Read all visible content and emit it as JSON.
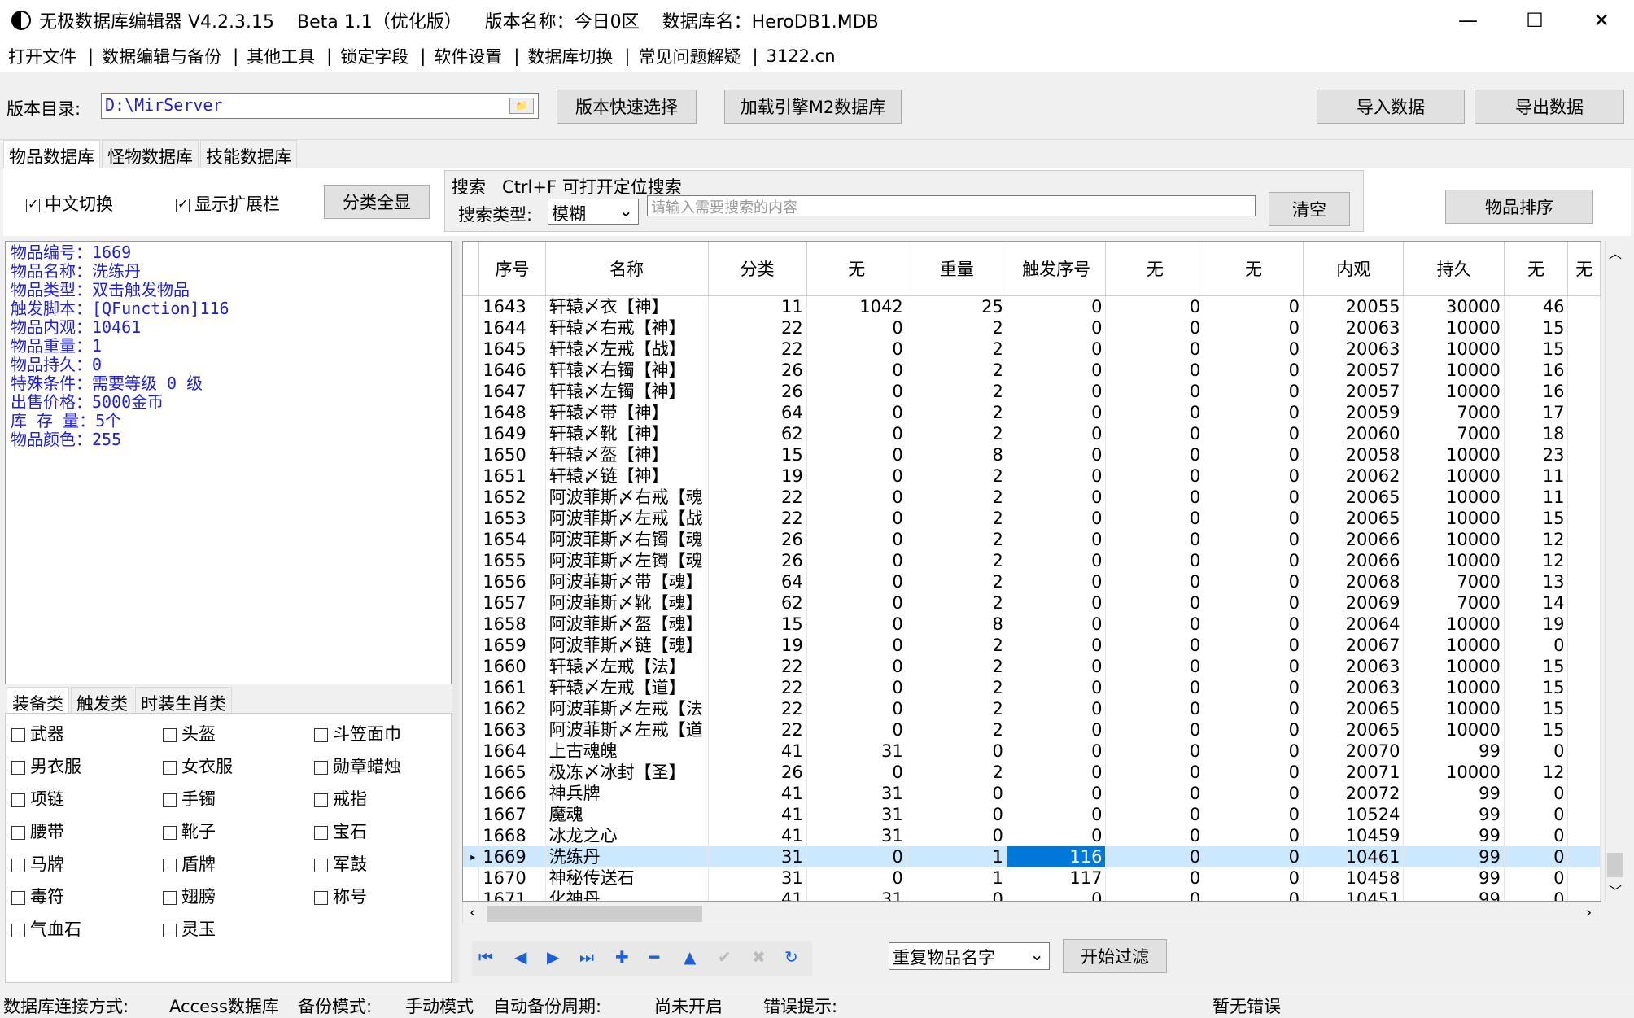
{
  "window": {
    "title": "无极数据库编辑器 V4.2.3.15    Beta 1.1（优化版）    版本名称：今日0区    数据库名：HeroDB1.MDB",
    "minimize": "—",
    "maximize": "☐",
    "close": "✕"
  },
  "menu": [
    "打开文件",
    "数据编辑与备份",
    "其他工具",
    "锁定字段",
    "软件设置",
    "数据库切换",
    "常见问题解疑",
    "3122.cn"
  ],
  "toolbar": {
    "dir_label": "版本目录:",
    "dir_value": "D:\\MirServer",
    "quick_select": "版本快速选择",
    "load_m2": "加载引擎M2数据库",
    "import": "导入数据",
    "export": "导出数据"
  },
  "main_tabs": [
    "物品数据库",
    "怪物数据库",
    "技能数据库"
  ],
  "options": {
    "cn_switch": "中文切换",
    "show_ext": "显示扩展栏",
    "show_all": "分类全显",
    "search_title": "搜索   Ctrl+F 可打开定位搜索",
    "search_type_label": "搜索类型:",
    "search_type_value": "模糊",
    "search_placeholder": "请输入需要搜索的内容",
    "clear": "清空",
    "sort": "物品排序"
  },
  "info": [
    "物品编号：1669",
    "物品名称：洗练丹",
    "物品类型：双击触发物品",
    "触发脚本：[QFunction]116",
    "物品内观：10461",
    "物品重量：1",
    "物品持久：0",
    "特殊条件：需要等级 0 级",
    "出售价格：5000金币",
    "库 存 量：5个",
    "物品颜色：255"
  ],
  "cat_tabs": [
    "装备类",
    "触发类",
    "时装生肖类"
  ],
  "categories": [
    "武器",
    "头盔",
    "斗笠面巾",
    "男衣服",
    "女衣服",
    "勋章蜡烛",
    "项链",
    "手镯",
    "戒指",
    "腰带",
    "靴子",
    "宝石",
    "马牌",
    "盾牌",
    "军鼓",
    "毒符",
    "翅膀",
    "称号",
    "气血石",
    "灵玉"
  ],
  "grid": {
    "headers": [
      "序号",
      "名称",
      "分类",
      "无",
      "重量",
      "触发序号",
      "无",
      "无",
      "内观",
      "持久",
      "无",
      "无"
    ],
    "rows": [
      [
        "1643",
        "轩辕〆衣【神】",
        "11",
        "1042",
        "25",
        "0",
        "0",
        "0",
        "20055",
        "30000",
        "46"
      ],
      [
        "1644",
        "轩辕〆右戒【神】",
        "22",
        "0",
        "2",
        "0",
        "0",
        "0",
        "20063",
        "10000",
        "15"
      ],
      [
        "1645",
        "轩辕〆左戒【战】",
        "22",
        "0",
        "2",
        "0",
        "0",
        "0",
        "20063",
        "10000",
        "15"
      ],
      [
        "1646",
        "轩辕〆右镯【神】",
        "26",
        "0",
        "2",
        "0",
        "0",
        "0",
        "20057",
        "10000",
        "16"
      ],
      [
        "1647",
        "轩辕〆左镯【神】",
        "26",
        "0",
        "2",
        "0",
        "0",
        "0",
        "20057",
        "10000",
        "16"
      ],
      [
        "1648",
        "轩辕〆带【神】",
        "64",
        "0",
        "2",
        "0",
        "0",
        "0",
        "20059",
        "7000",
        "17"
      ],
      [
        "1649",
        "轩辕〆靴【神】",
        "62",
        "0",
        "2",
        "0",
        "0",
        "0",
        "20060",
        "7000",
        "18"
      ],
      [
        "1650",
        "轩辕〆盔【神】",
        "15",
        "0",
        "8",
        "0",
        "0",
        "0",
        "20058",
        "10000",
        "23"
      ],
      [
        "1651",
        "轩辕〆链【神】",
        "19",
        "0",
        "2",
        "0",
        "0",
        "0",
        "20062",
        "10000",
        "11"
      ],
      [
        "1652",
        "阿波菲斯〆右戒【魂",
        "22",
        "0",
        "2",
        "0",
        "0",
        "0",
        "20065",
        "10000",
        "11"
      ],
      [
        "1653",
        "阿波菲斯〆左戒【战",
        "22",
        "0",
        "2",
        "0",
        "0",
        "0",
        "20065",
        "10000",
        "15"
      ],
      [
        "1654",
        "阿波菲斯〆右镯【魂",
        "26",
        "0",
        "2",
        "0",
        "0",
        "0",
        "20066",
        "10000",
        "12"
      ],
      [
        "1655",
        "阿波菲斯〆左镯【魂",
        "26",
        "0",
        "2",
        "0",
        "0",
        "0",
        "20066",
        "10000",
        "12"
      ],
      [
        "1656",
        "阿波菲斯〆带【魂】",
        "64",
        "0",
        "2",
        "0",
        "0",
        "0",
        "20068",
        "7000",
        "13"
      ],
      [
        "1657",
        "阿波菲斯〆靴【魂】",
        "62",
        "0",
        "2",
        "0",
        "0",
        "0",
        "20069",
        "7000",
        "14"
      ],
      [
        "1658",
        "阿波菲斯〆盔【魂】",
        "15",
        "0",
        "8",
        "0",
        "0",
        "0",
        "20064",
        "10000",
        "19"
      ],
      [
        "1659",
        "阿波菲斯〆链【魂】",
        "19",
        "0",
        "2",
        "0",
        "0",
        "0",
        "20067",
        "10000",
        "0"
      ],
      [
        "1660",
        "轩辕〆左戒【法】",
        "22",
        "0",
        "2",
        "0",
        "0",
        "0",
        "20063",
        "10000",
        "15"
      ],
      [
        "1661",
        "轩辕〆左戒【道】",
        "22",
        "0",
        "2",
        "0",
        "0",
        "0",
        "20063",
        "10000",
        "15"
      ],
      [
        "1662",
        "阿波菲斯〆左戒【法",
        "22",
        "0",
        "2",
        "0",
        "0",
        "0",
        "20065",
        "10000",
        "15"
      ],
      [
        "1663",
        "阿波菲斯〆左戒【道",
        "22",
        "0",
        "2",
        "0",
        "0",
        "0",
        "20065",
        "10000",
        "15"
      ],
      [
        "1664",
        "上古魂魄",
        "41",
        "31",
        "0",
        "0",
        "0",
        "0",
        "20070",
        "99",
        "0"
      ],
      [
        "1665",
        "极冻〆冰封【圣】",
        "26",
        "0",
        "2",
        "0",
        "0",
        "0",
        "20071",
        "10000",
        "12"
      ],
      [
        "1666",
        "神兵牌",
        "41",
        "31",
        "0",
        "0",
        "0",
        "0",
        "20072",
        "99",
        "0"
      ],
      [
        "1667",
        "魔魂",
        "41",
        "31",
        "0",
        "0",
        "0",
        "0",
        "10524",
        "99",
        "0"
      ],
      [
        "1668",
        "冰龙之心",
        "41",
        "31",
        "0",
        "0",
        "0",
        "0",
        "10459",
        "99",
        "0"
      ],
      [
        "1669",
        "洗练丹",
        "31",
        "0",
        "1",
        "116",
        "0",
        "0",
        "10461",
        "99",
        "0"
      ],
      [
        "1670",
        "神秘传送石",
        "31",
        "0",
        "1",
        "117",
        "0",
        "0",
        "10458",
        "99",
        "0"
      ],
      [
        "1671",
        "化神丹",
        "41",
        "31",
        "0",
        "0",
        "0",
        "0",
        "10451",
        "99",
        "0"
      ]
    ],
    "selected_row": 26
  },
  "bottom": {
    "filter_value": "重复物品名字",
    "filter_button": "开始过滤"
  },
  "status": {
    "conn_label": "数据库连接方式:",
    "conn_value": "Access数据库",
    "backup_label": "备份模式:",
    "backup_value": "手动模式",
    "auto_label": "自动备份周期:",
    "auto_value": "尚未开启",
    "err_label": "错误提示:",
    "err_value": "暂无错误"
  },
  "colors": {
    "info_text": "#2222cc",
    "selection": "#cce8ff",
    "highlight": "#0078d7"
  }
}
